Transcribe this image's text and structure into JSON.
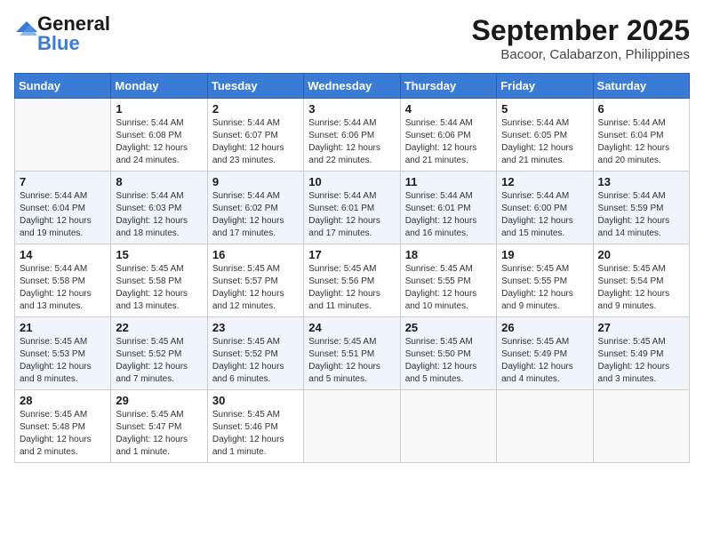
{
  "logo": {
    "general": "General",
    "blue": "Blue"
  },
  "header": {
    "month": "September 2025",
    "location": "Bacoor, Calabarzon, Philippines"
  },
  "weekdays": [
    "Sunday",
    "Monday",
    "Tuesday",
    "Wednesday",
    "Thursday",
    "Friday",
    "Saturday"
  ],
  "weeks": [
    [
      {
        "day": "",
        "info": ""
      },
      {
        "day": "1",
        "info": "Sunrise: 5:44 AM\nSunset: 6:08 PM\nDaylight: 12 hours\nand 24 minutes."
      },
      {
        "day": "2",
        "info": "Sunrise: 5:44 AM\nSunset: 6:07 PM\nDaylight: 12 hours\nand 23 minutes."
      },
      {
        "day": "3",
        "info": "Sunrise: 5:44 AM\nSunset: 6:06 PM\nDaylight: 12 hours\nand 22 minutes."
      },
      {
        "day": "4",
        "info": "Sunrise: 5:44 AM\nSunset: 6:06 PM\nDaylight: 12 hours\nand 21 minutes."
      },
      {
        "day": "5",
        "info": "Sunrise: 5:44 AM\nSunset: 6:05 PM\nDaylight: 12 hours\nand 21 minutes."
      },
      {
        "day": "6",
        "info": "Sunrise: 5:44 AM\nSunset: 6:04 PM\nDaylight: 12 hours\nand 20 minutes."
      }
    ],
    [
      {
        "day": "7",
        "info": "Sunrise: 5:44 AM\nSunset: 6:04 PM\nDaylight: 12 hours\nand 19 minutes."
      },
      {
        "day": "8",
        "info": "Sunrise: 5:44 AM\nSunset: 6:03 PM\nDaylight: 12 hours\nand 18 minutes."
      },
      {
        "day": "9",
        "info": "Sunrise: 5:44 AM\nSunset: 6:02 PM\nDaylight: 12 hours\nand 17 minutes."
      },
      {
        "day": "10",
        "info": "Sunrise: 5:44 AM\nSunset: 6:01 PM\nDaylight: 12 hours\nand 17 minutes."
      },
      {
        "day": "11",
        "info": "Sunrise: 5:44 AM\nSunset: 6:01 PM\nDaylight: 12 hours\nand 16 minutes."
      },
      {
        "day": "12",
        "info": "Sunrise: 5:44 AM\nSunset: 6:00 PM\nDaylight: 12 hours\nand 15 minutes."
      },
      {
        "day": "13",
        "info": "Sunrise: 5:44 AM\nSunset: 5:59 PM\nDaylight: 12 hours\nand 14 minutes."
      }
    ],
    [
      {
        "day": "14",
        "info": "Sunrise: 5:44 AM\nSunset: 5:58 PM\nDaylight: 12 hours\nand 13 minutes."
      },
      {
        "day": "15",
        "info": "Sunrise: 5:45 AM\nSunset: 5:58 PM\nDaylight: 12 hours\nand 13 minutes."
      },
      {
        "day": "16",
        "info": "Sunrise: 5:45 AM\nSunset: 5:57 PM\nDaylight: 12 hours\nand 12 minutes."
      },
      {
        "day": "17",
        "info": "Sunrise: 5:45 AM\nSunset: 5:56 PM\nDaylight: 12 hours\nand 11 minutes."
      },
      {
        "day": "18",
        "info": "Sunrise: 5:45 AM\nSunset: 5:55 PM\nDaylight: 12 hours\nand 10 minutes."
      },
      {
        "day": "19",
        "info": "Sunrise: 5:45 AM\nSunset: 5:55 PM\nDaylight: 12 hours\nand 9 minutes."
      },
      {
        "day": "20",
        "info": "Sunrise: 5:45 AM\nSunset: 5:54 PM\nDaylight: 12 hours\nand 9 minutes."
      }
    ],
    [
      {
        "day": "21",
        "info": "Sunrise: 5:45 AM\nSunset: 5:53 PM\nDaylight: 12 hours\nand 8 minutes."
      },
      {
        "day": "22",
        "info": "Sunrise: 5:45 AM\nSunset: 5:52 PM\nDaylight: 12 hours\nand 7 minutes."
      },
      {
        "day": "23",
        "info": "Sunrise: 5:45 AM\nSunset: 5:52 PM\nDaylight: 12 hours\nand 6 minutes."
      },
      {
        "day": "24",
        "info": "Sunrise: 5:45 AM\nSunset: 5:51 PM\nDaylight: 12 hours\nand 5 minutes."
      },
      {
        "day": "25",
        "info": "Sunrise: 5:45 AM\nSunset: 5:50 PM\nDaylight: 12 hours\nand 5 minutes."
      },
      {
        "day": "26",
        "info": "Sunrise: 5:45 AM\nSunset: 5:49 PM\nDaylight: 12 hours\nand 4 minutes."
      },
      {
        "day": "27",
        "info": "Sunrise: 5:45 AM\nSunset: 5:49 PM\nDaylight: 12 hours\nand 3 minutes."
      }
    ],
    [
      {
        "day": "28",
        "info": "Sunrise: 5:45 AM\nSunset: 5:48 PM\nDaylight: 12 hours\nand 2 minutes."
      },
      {
        "day": "29",
        "info": "Sunrise: 5:45 AM\nSunset: 5:47 PM\nDaylight: 12 hours\nand 1 minute."
      },
      {
        "day": "30",
        "info": "Sunrise: 5:45 AM\nSunset: 5:46 PM\nDaylight: 12 hours\nand 1 minute."
      },
      {
        "day": "",
        "info": ""
      },
      {
        "day": "",
        "info": ""
      },
      {
        "day": "",
        "info": ""
      },
      {
        "day": "",
        "info": ""
      }
    ]
  ]
}
